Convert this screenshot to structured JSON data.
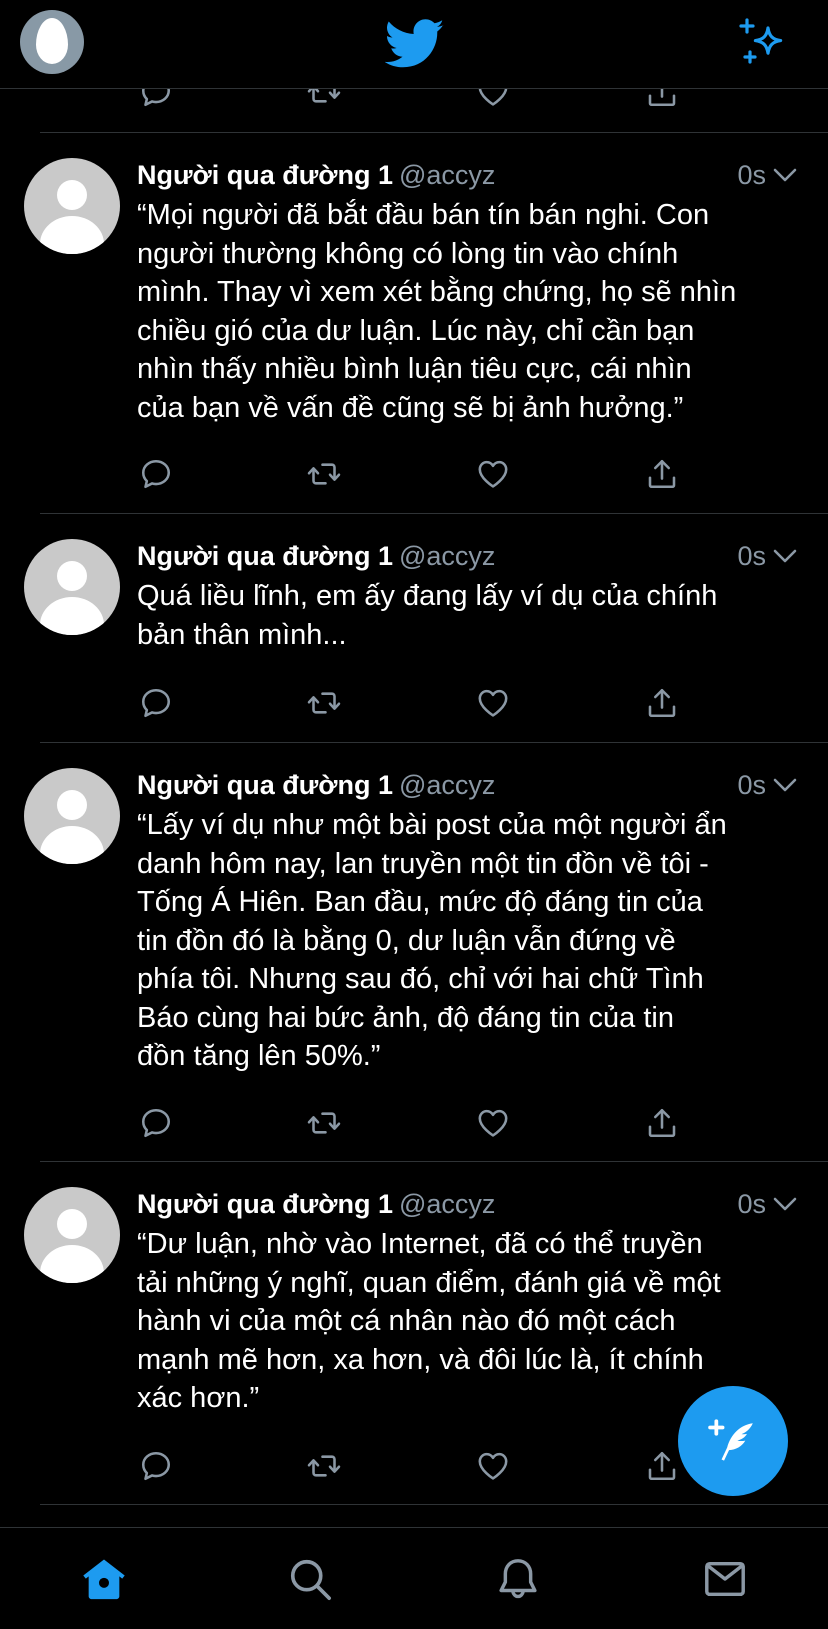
{
  "colors": {
    "accent": "#1d9bf0",
    "background": "#000000",
    "secondary_text": "#8b98a5",
    "divider": "#2f3336"
  },
  "top_bar": {
    "left_icon": "profile-egg-avatar",
    "center_icon": "twitter-bird-icon",
    "right_icon": "sparkle-icon"
  },
  "tweets": [
    {
      "name": "Người qua đường 1",
      "handle": "@accyz",
      "time": "0s",
      "text": "“Mọi người đã bắt đầu bán tín bán nghi. Con\nngười thường không có lòng tin vào chính\nmình. Thay vì xem xét bằng chứng, họ sẽ nhìn\nchiều gió của dư luận. Lúc này, chỉ cần bạn\nnhìn thấy nhiều bình luận tiêu cực, cái nhìn\ncủa bạn về vấn đề cũng sẽ bị ảnh hưởng.”"
    },
    {
      "name": "Người qua đường 1",
      "handle": "@accyz",
      "time": "0s",
      "text": "Quá liều lĩnh, em ấy đang lấy ví dụ của chính\nbản thân mình..."
    },
    {
      "name": "Người qua đường 1",
      "handle": "@accyz",
      "time": "0s",
      "text": "“Lấy ví dụ như một bài post của một người ẩn\ndanh hôm nay, lan truyền một tin đồn về tôi -\nTống Á Hiên. Ban đầu, mức độ đáng tin của\ntin đồn đó là bằng 0, dư luận vẫn đứng về\nphía tôi. Nhưng sau đó, chỉ với hai chữ Tình\nBáo cùng hai bức ảnh, độ đáng tin của tin\nđồn tăng lên 50%.”"
    },
    {
      "name": "Người qua đường 1",
      "handle": "@accyz",
      "time": "0s",
      "text": "“Dư luận, nhờ vào Internet, đã có thể truyền\ntải những ý nghĩ, quan điểm, đánh giá về một\nhành vi của một cá nhân nào đó một cách\nmạnh mẽ hơn, xa hơn, và đôi lúc là, ít chính\nxác hơn.”"
    }
  ],
  "bottom_tabs": [
    "home-icon",
    "search-icon",
    "notifications-icon",
    "messages-icon"
  ],
  "fab_icon": "compose-tweet-icon"
}
